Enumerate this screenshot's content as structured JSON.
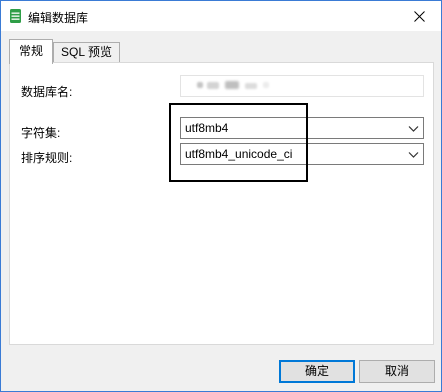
{
  "window": {
    "title": "编辑数据库",
    "icon": "database-icon",
    "close_icon": "close-icon"
  },
  "tabs": [
    {
      "label": "常规",
      "active": true
    },
    {
      "label": "SQL 预览",
      "active": false
    }
  ],
  "form": {
    "name_label": "数据库名:",
    "name_value": "",
    "charset_label": "字符集:",
    "charset_value": "utf8mb4",
    "collation_label": "排序规则:",
    "collation_value": "utf8mb4_unicode_ci"
  },
  "buttons": {
    "ok": "确定",
    "cancel": "取消"
  },
  "colors": {
    "icon_green": "#2e9e47",
    "focus_blue": "#0078d7",
    "window_border": "#3a7bd5"
  }
}
